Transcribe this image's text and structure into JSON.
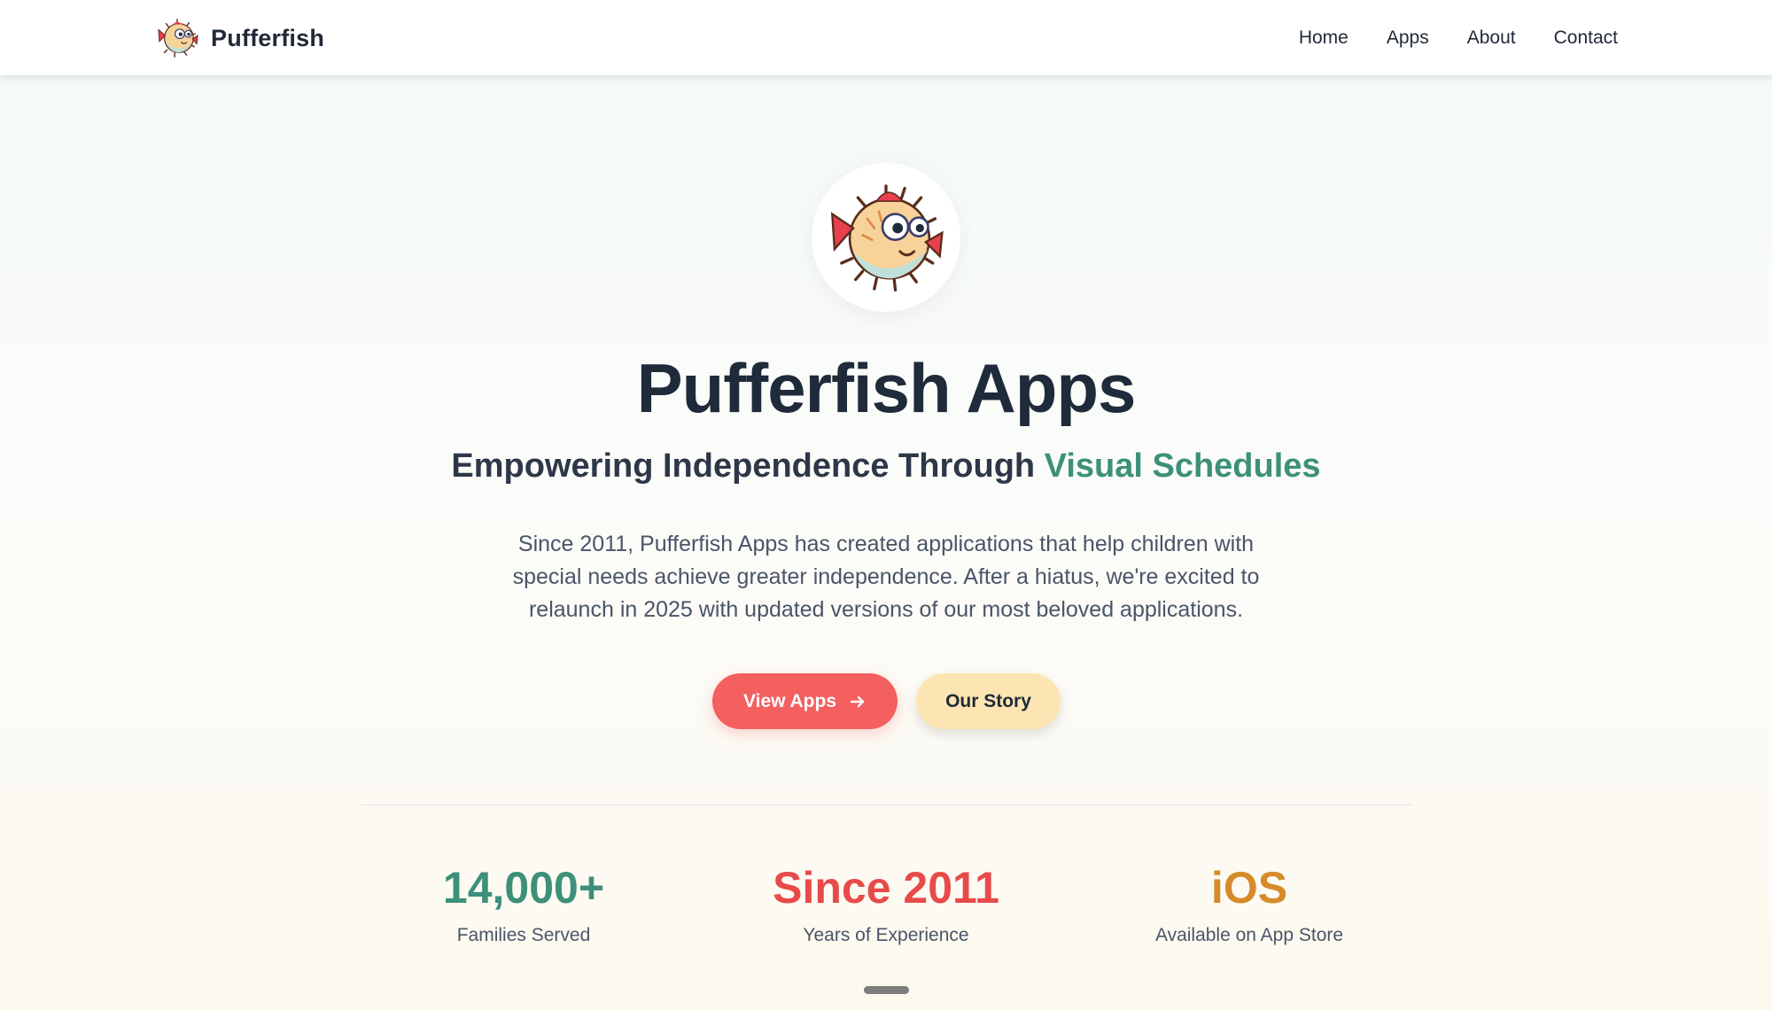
{
  "header": {
    "brand_name": "Pufferfish",
    "nav": [
      {
        "label": "Home"
      },
      {
        "label": "Apps"
      },
      {
        "label": "About"
      },
      {
        "label": "Contact"
      }
    ]
  },
  "hero": {
    "title": "Pufferfish Apps",
    "subtitle_main": "Empowering Independence Through ",
    "subtitle_accent": "Visual Schedules",
    "description": "Since 2011, Pufferfish Apps has created applications that help children with special needs achieve greater independence. After a hiatus, we're excited to relaunch in 2025 with updated versions of our most beloved applications.",
    "primary_button": "View Apps",
    "secondary_button": "Our Story"
  },
  "stats": [
    {
      "value": "14,000+",
      "label": "Families Served"
    },
    {
      "value": "Since 2011",
      "label": "Years of Experience"
    },
    {
      "value": "iOS",
      "label": "Available on App Store"
    }
  ],
  "colors": {
    "accent_green": "#3d9079",
    "primary_red": "#f45f5f",
    "secondary_cream": "#fce5b2",
    "stat_orange": "#d58b2a"
  },
  "icons": [
    "pufferfish-logo-icon",
    "arrow-right-icon"
  ]
}
